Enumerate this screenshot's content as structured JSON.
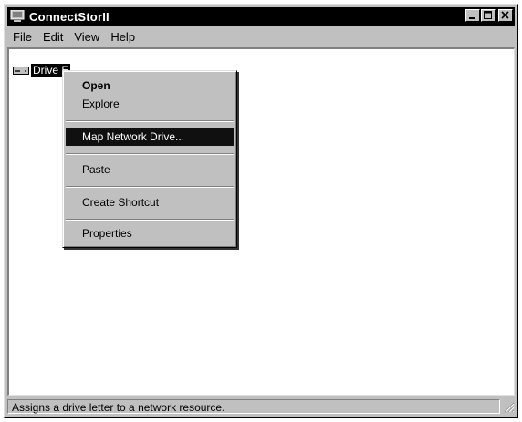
{
  "window": {
    "title": "ConnectStorII"
  },
  "menubar": {
    "items": [
      {
        "label": "File"
      },
      {
        "label": "Edit"
      },
      {
        "label": "View"
      },
      {
        "label": "Help"
      }
    ]
  },
  "tree": {
    "selected_item": "Drive E"
  },
  "context_menu": {
    "items": [
      {
        "label": "Open"
      },
      {
        "label": "Explore"
      },
      {
        "label": "Map Network Drive..."
      },
      {
        "label": "Paste"
      },
      {
        "label": "Create Shortcut"
      },
      {
        "label": "Properties"
      }
    ]
  },
  "statusbar": {
    "text": "Assigns a drive letter to a network resource."
  },
  "icons": {
    "app": "computer-icon",
    "drive": "drive-icon",
    "minimize": "minimize-icon",
    "maximize": "maximize-icon",
    "close": "close-icon",
    "grip": "resize-grip-icon"
  },
  "colors": {
    "title_bar": "#000000",
    "menu_highlight": "#101010",
    "chrome": "#c0c0c0"
  }
}
